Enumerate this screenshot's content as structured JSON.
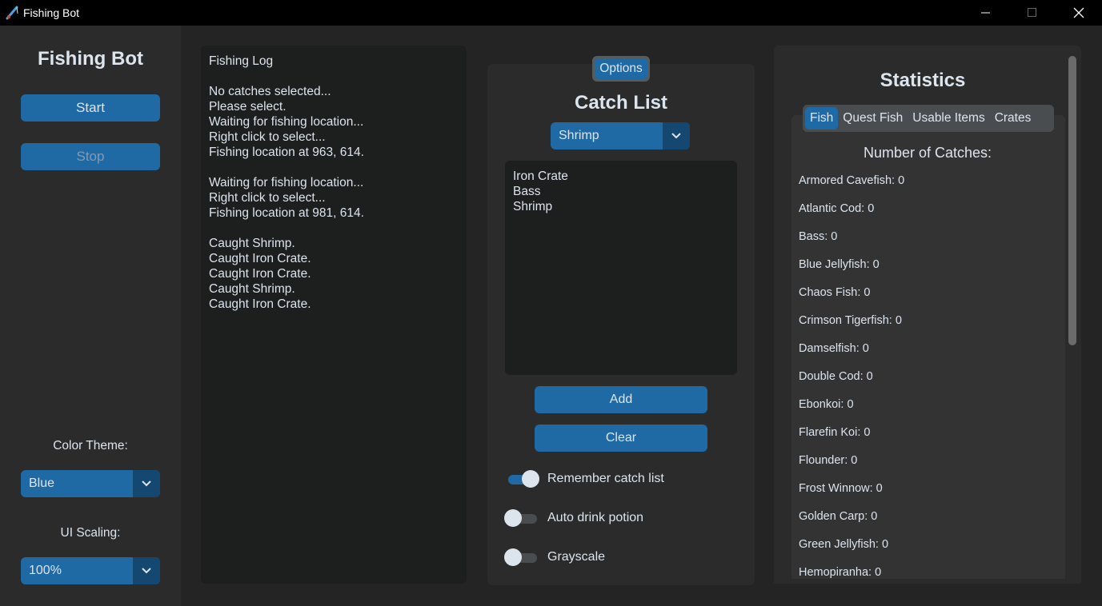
{
  "window": {
    "title": "Fishing Bot",
    "controls": [
      "minimize",
      "maximize",
      "close"
    ]
  },
  "sidebar": {
    "title": "Fishing Bot",
    "start_label": "Start",
    "stop_label": "Stop",
    "color_theme_label": "Color Theme:",
    "color_theme_value": "Blue",
    "ui_scaling_label": "UI Scaling:",
    "ui_scaling_value": "100%"
  },
  "log": {
    "lines": [
      "Fishing Log",
      "",
      "No catches selected...",
      "Please select.",
      "Waiting for fishing location...",
      "Right click to select...",
      "Fishing location at 963, 614.",
      "",
      "Waiting for fishing location...",
      "Right click to select...",
      "Fishing location at 981, 614.",
      "",
      "Caught Shrimp.",
      "Caught Iron Crate.",
      "Caught Iron Crate.",
      "Caught Shrimp.",
      "Caught Iron Crate."
    ]
  },
  "catch": {
    "options_label": "Options",
    "title": "Catch List",
    "selected": "Shrimp",
    "items": [
      "Iron Crate",
      "Bass",
      "Shrimp"
    ],
    "add_label": "Add",
    "clear_label": "Clear",
    "switches": [
      {
        "label": "Remember catch list",
        "on": true
      },
      {
        "label": "Auto drink potion",
        "on": false
      },
      {
        "label": "Grayscale",
        "on": false
      }
    ]
  },
  "stats": {
    "title": "Statistics",
    "tabs": [
      "Fish",
      "Quest Fish",
      "Usable Items",
      "Crates"
    ],
    "active_tab": "Fish",
    "heading": "Number of Catches:",
    "lines": [
      "Armored Cavefish: 0",
      "Atlantic Cod: 0",
      "Bass: 0",
      "Blue Jellyfish: 0",
      "Chaos Fish: 0",
      "Crimson Tigerfish: 0",
      "Damselfish: 0",
      "Double Cod: 0",
      "Ebonkoi: 0",
      "Flarefin Koi: 0",
      "Flounder: 0",
      "Frost Winnow: 0",
      "Golden Carp: 0",
      "Green Jellyfish: 0",
      "Hemopiranha: 0"
    ]
  },
  "colors": {
    "accent": "#1f6aa5",
    "accent_dark": "#144870",
    "panel": "#2b2b2b",
    "bg": "#242424",
    "textbox": "#1d1e1e",
    "text": "#dce4ee"
  }
}
